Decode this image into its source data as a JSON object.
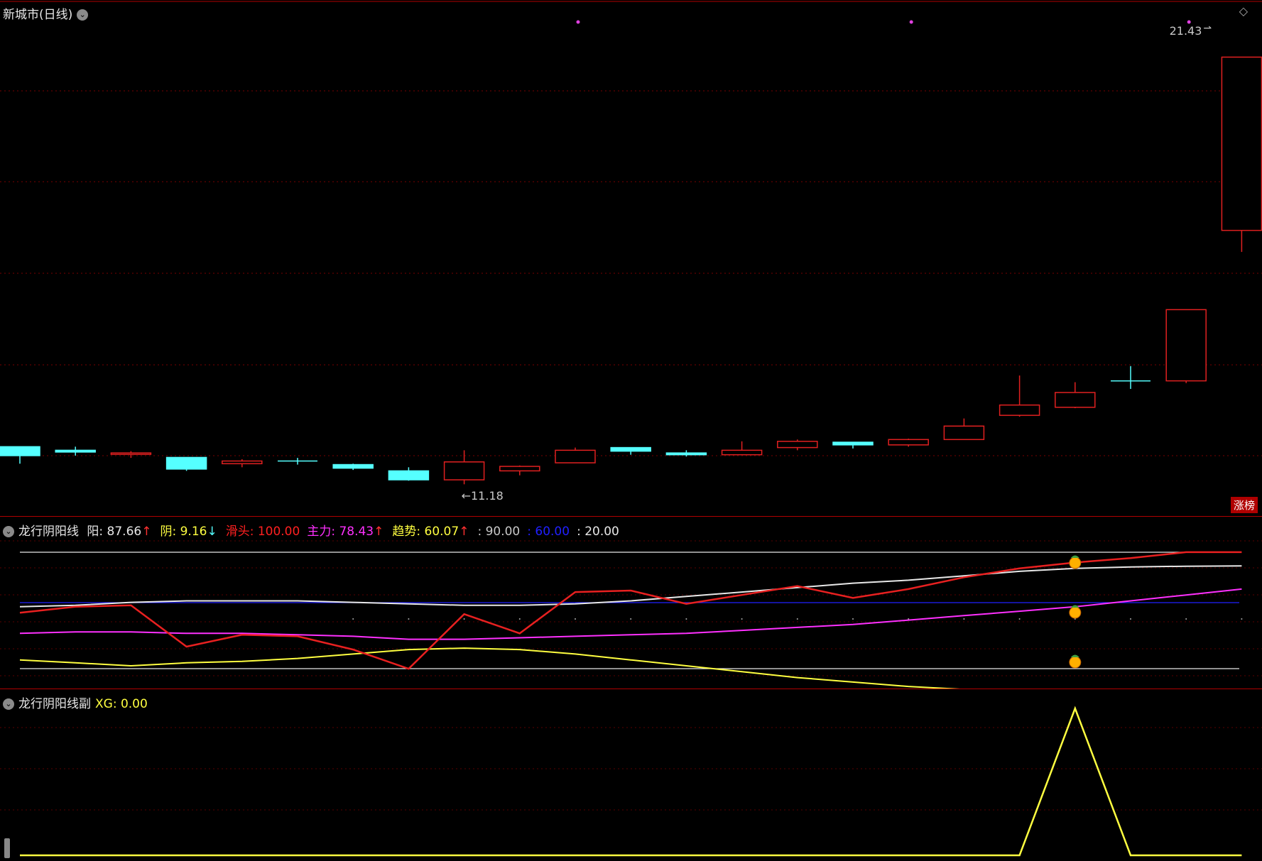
{
  "main": {
    "title": "新城市",
    "period": "(日线)",
    "high_label": "21.43",
    "low_label": "←11.18",
    "tag": "涨榜",
    "colors": {
      "up": "#e02020",
      "down": "#55ffff",
      "grid": "#7a0000"
    }
  },
  "candles": [
    {
      "o": 12.1,
      "c": 11.9,
      "h": 12.1,
      "l": 11.72
    },
    {
      "o": 12.02,
      "c": 11.98,
      "h": 12.1,
      "l": 11.9
    },
    {
      "o": 11.94,
      "c": 11.96,
      "h": 12.0,
      "l": 11.85
    },
    {
      "o": 11.86,
      "c": 11.6,
      "h": 11.86,
      "l": 11.56
    },
    {
      "o": 11.72,
      "c": 11.78,
      "h": 11.82,
      "l": 11.64
    },
    {
      "o": 11.78,
      "c": 11.78,
      "h": 11.85,
      "l": 11.7
    },
    {
      "o": 11.7,
      "c": 11.62,
      "h": 11.72,
      "l": 11.58
    },
    {
      "o": 11.56,
      "c": 11.36,
      "h": 11.64,
      "l": 11.34
    },
    {
      "o": 11.36,
      "c": 11.76,
      "h": 12.02,
      "l": 11.26
    },
    {
      "o": 11.56,
      "c": 11.66,
      "h": 11.68,
      "l": 11.46
    },
    {
      "o": 11.74,
      "c": 12.02,
      "h": 12.08,
      "l": 11.74
    },
    {
      "o": 12.08,
      "c": 12.0,
      "h": 12.08,
      "l": 11.92
    },
    {
      "o": 11.96,
      "c": 11.92,
      "h": 12.02,
      "l": 11.88
    },
    {
      "o": 11.92,
      "c": 12.02,
      "h": 12.22,
      "l": 11.92
    },
    {
      "o": 12.08,
      "c": 12.22,
      "h": 12.26,
      "l": 12.02
    },
    {
      "o": 12.2,
      "c": 12.14,
      "h": 12.2,
      "l": 12.06
    },
    {
      "o": 12.14,
      "c": 12.26,
      "h": 12.28,
      "l": 12.1
    },
    {
      "o": 12.26,
      "c": 12.56,
      "h": 12.73,
      "l": 12.26
    },
    {
      "o": 12.8,
      "c": 13.03,
      "h": 13.69,
      "l": 12.77
    },
    {
      "o": 12.98,
      "c": 13.31,
      "h": 13.54,
      "l": 12.96
    },
    {
      "o": 13.57,
      "c": 13.57,
      "h": 13.9,
      "l": 13.39
    },
    {
      "o": 13.57,
      "c": 15.16,
      "h": 15.16,
      "l": 13.52
    },
    {
      "o": 16.93,
      "c": 20.8,
      "h": 20.8,
      "l": 16.45
    }
  ],
  "marks": [
    10,
    16,
    21
  ],
  "indicator": {
    "title": "龙行阴阳线",
    "items": [
      {
        "label": "阳: ",
        "value": "87.66",
        "arrow": "↑",
        "color": "#e8e8e8",
        "arrow_color": "#ff3030"
      },
      {
        "label": "阴: ",
        "value": "9.16",
        "arrow": "↓",
        "color": "#ffff40",
        "arrow_color": "#55ffff"
      },
      {
        "label": "滑头: ",
        "value": "100.00",
        "arrow": "",
        "color": "#ff2020",
        "arrow_color": ""
      },
      {
        "label": "主力: ",
        "value": "78.43",
        "arrow": "↑",
        "color": "#ff30ff",
        "arrow_color": "#ff3030"
      },
      {
        "label": "趋势: ",
        "value": "60.07",
        "arrow": "↑",
        "color": "#ffff40",
        "arrow_color": "#ff3030"
      },
      {
        "label": ": ",
        "value": "90.00",
        "arrow": "",
        "color": "#c8c8c8",
        "arrow_color": ""
      },
      {
        "label": ": ",
        "value": "60.00",
        "arrow": "",
        "color": "#2020ff",
        "arrow_color": ""
      },
      {
        "label": ": ",
        "value": "20.00",
        "arrow": "",
        "color": "#e8e8e8",
        "arrow_color": ""
      }
    ],
    "levels": [
      90,
      60,
      20
    ],
    "series": {
      "yang": [
        60,
        61,
        63,
        64,
        64,
        64,
        63,
        62,
        61,
        61,
        62,
        64,
        67,
        70,
        73,
        76,
        78,
        81,
        84,
        86,
        87,
        87.5,
        87.7
      ],
      "hua": [
        56,
        60,
        61,
        33,
        41,
        40,
        31,
        18,
        55,
        42,
        70,
        71,
        62,
        68,
        74,
        66,
        72,
        80,
        86,
        90,
        93,
        97,
        97
      ],
      "zhu": [
        42,
        43,
        43,
        42,
        42,
        41,
        40,
        38,
        38,
        39,
        40,
        41,
        42,
        44,
        46,
        48,
        51,
        54,
        57,
        60,
        64,
        68,
        72
      ],
      "qu": [
        24,
        22,
        20,
        22,
        23,
        25,
        28,
        31,
        32,
        31,
        28,
        24,
        20,
        16,
        12,
        9,
        6,
        4,
        3,
        3,
        3,
        2,
        1
      ]
    },
    "fruit_index": 19
  },
  "sub": {
    "title": "龙行阴阳线副",
    "xg_label": "XG: ",
    "xg_value": "0.00",
    "xg": [
      0,
      0,
      0,
      0,
      0,
      0,
      0,
      0,
      0,
      0,
      0,
      0,
      0,
      0,
      0,
      0,
      0,
      0,
      0,
      1,
      0,
      0,
      0
    ]
  }
}
